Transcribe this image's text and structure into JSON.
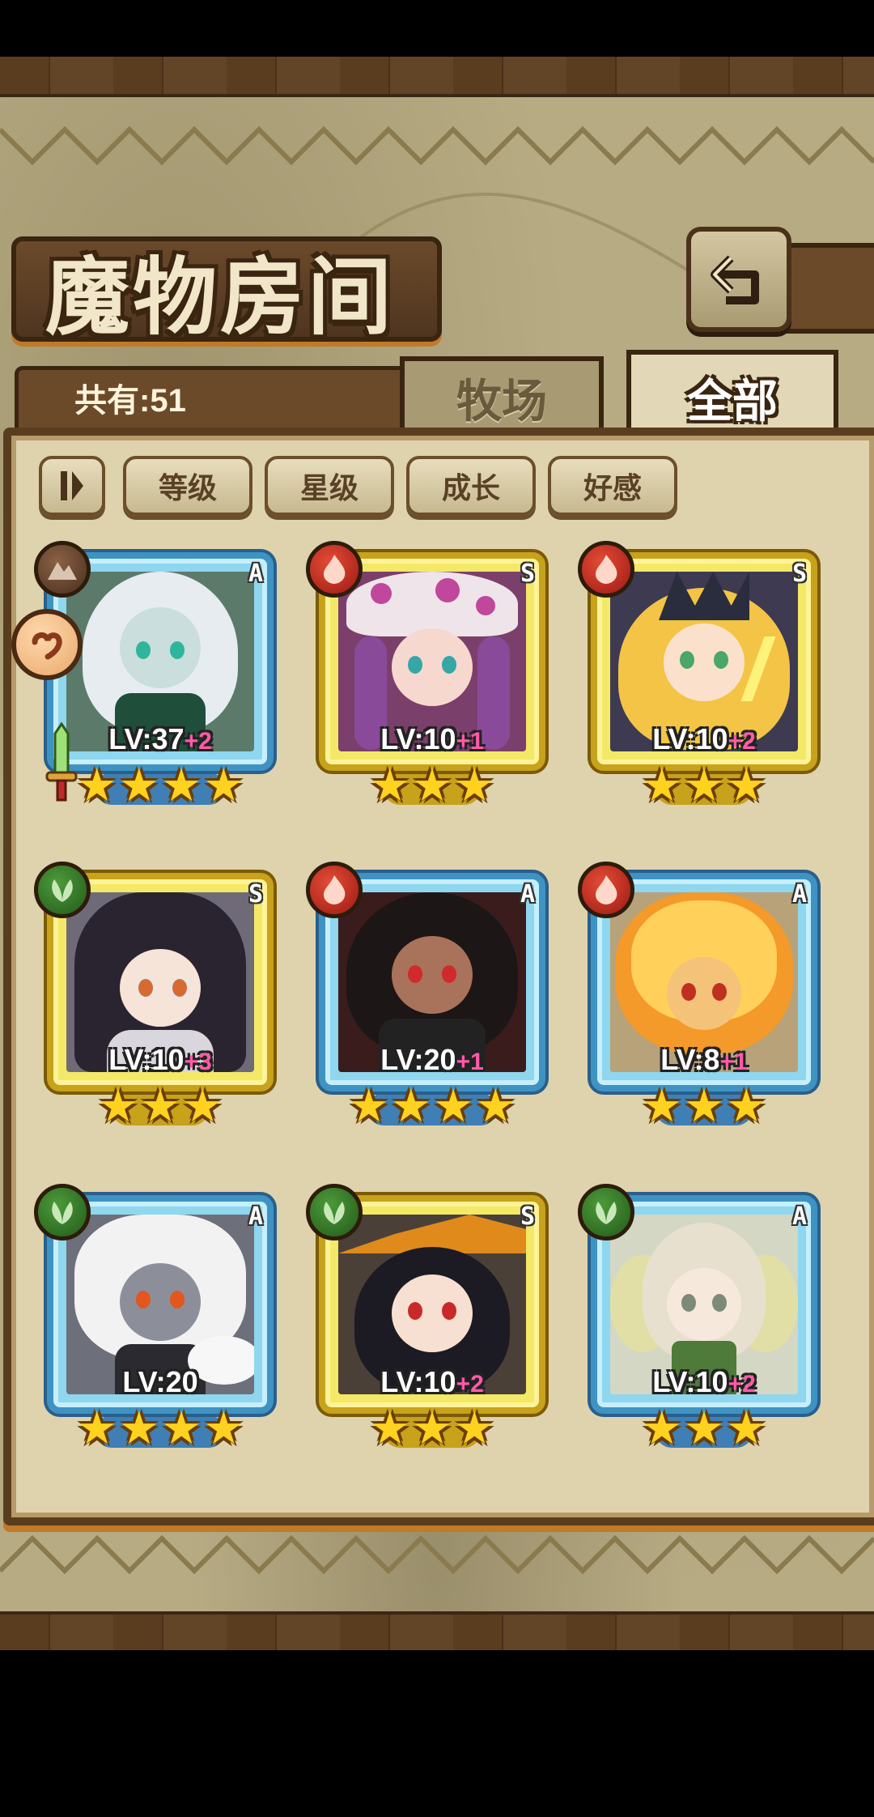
{
  "header": {
    "title": "魔物房间",
    "count_text": "共有:51"
  },
  "tabs": [
    {
      "label": "牧场",
      "active": false
    },
    {
      "label": "全部",
      "active": true
    }
  ],
  "sort_buttons": [
    "等级",
    "星级",
    "成长",
    "好感"
  ],
  "icons": {
    "back": "back-arrow-icon",
    "sort_order": "sort-order-icon",
    "favorite_badge": "heart-badge-icon",
    "equipped_badge": "sword-icon"
  },
  "cards": [
    {
      "level": "LV:37",
      "plus": "+2",
      "rarity": "A",
      "element": "earth",
      "stars": 4
    },
    {
      "level": "LV:10",
      "plus": "+1",
      "rarity": "S",
      "element": "fire",
      "stars": 3
    },
    {
      "level": "LV:10",
      "plus": "+2",
      "rarity": "S",
      "element": "fire",
      "stars": 3
    },
    {
      "level": "LV:10",
      "plus": "+3",
      "rarity": "S",
      "element": "grass",
      "stars": 3
    },
    {
      "level": "LV:20",
      "plus": "+1",
      "rarity": "A",
      "element": "fire",
      "stars": 4
    },
    {
      "level": "LV:8",
      "plus": "+1",
      "rarity": "A",
      "element": "fire",
      "stars": 3
    },
    {
      "level": "LV:20",
      "plus": "",
      "rarity": "A",
      "element": "grass",
      "stars": 4
    },
    {
      "level": "LV:10",
      "plus": "+2",
      "rarity": "S",
      "element": "grass",
      "stars": 3
    },
    {
      "level": "LV:10",
      "plus": "+2",
      "rarity": "A",
      "element": "grass",
      "stars": 3
    }
  ],
  "colors": {
    "fire": "#c8281c",
    "grass": "#3a7d2c",
    "earth": "#6a4632",
    "rarity_a_frame": "#3f93c3",
    "rarity_s_frame": "#c7a21a",
    "plus_text": "#ff5aa8"
  }
}
